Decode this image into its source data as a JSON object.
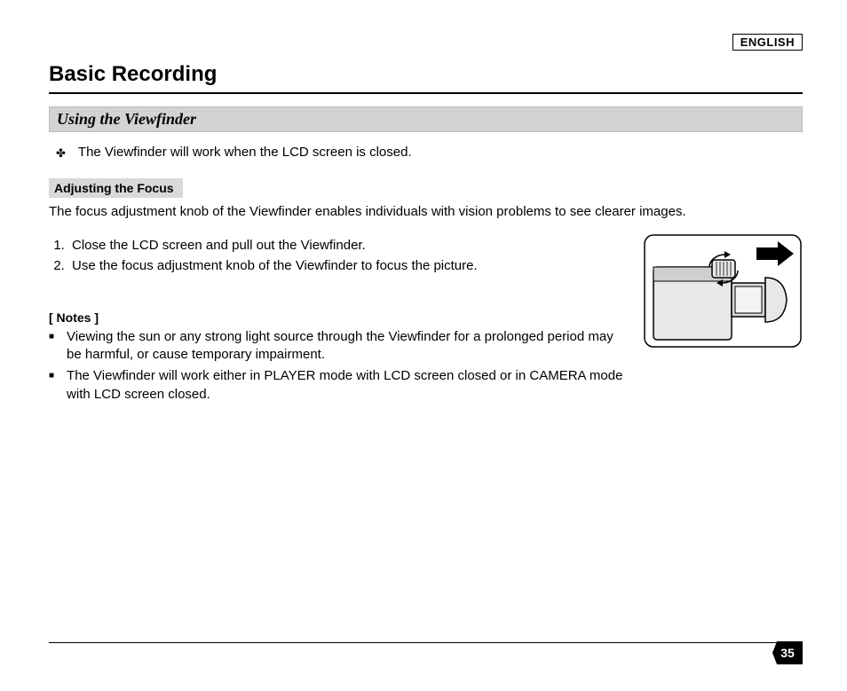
{
  "language_badge": "ENGLISH",
  "page_title": "Basic Recording",
  "section_heading": "Using the Viewfinder",
  "intro_line": "The Viewfinder will work when the LCD screen is closed.",
  "sub_heading": "Adjusting the Focus",
  "focus_desc": "The focus adjustment knob of the Viewfinder enables individuals with vision problems to see clearer images.",
  "steps": [
    "Close the LCD screen and pull out the Viewfinder.",
    "Use the focus adjustment knob of the Viewfinder to focus the picture."
  ],
  "notes_label": "[ Notes ]",
  "notes": [
    "Viewing the sun or any strong light source through the Viewfinder for a prolonged period may be harmful, or cause temporary impairment.",
    "The Viewfinder will work either in PLAYER mode with LCD screen closed or in CAMERA mode with LCD screen closed."
  ],
  "page_number": "35"
}
